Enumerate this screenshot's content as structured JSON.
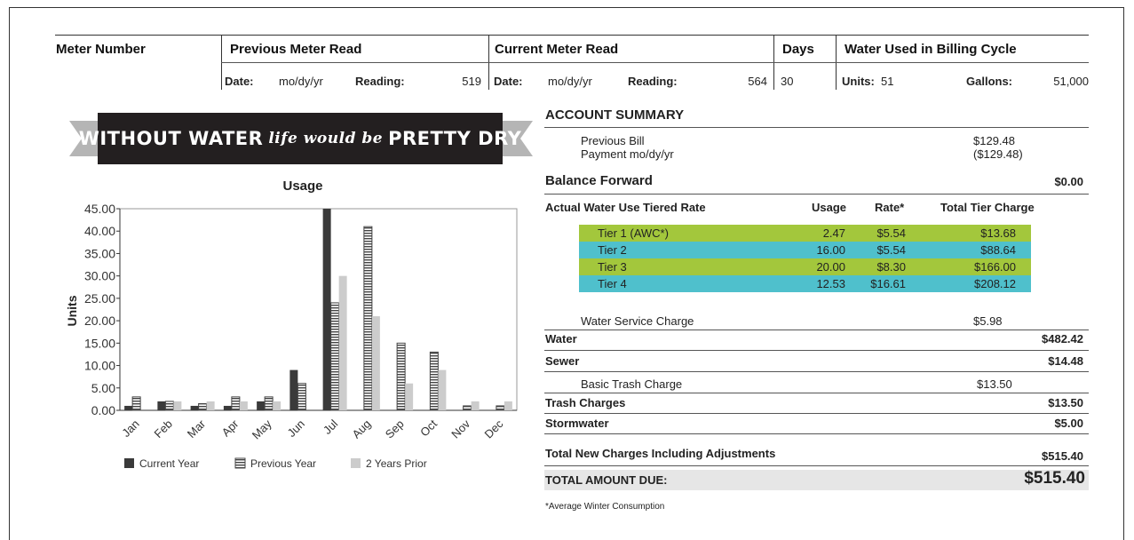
{
  "header": {
    "meter_number": "Meter Number",
    "previous_meter_read": "Previous Meter Read",
    "current_meter_read": "Current Meter Read",
    "days": "Days",
    "water_used": "Water Used in Billing Cycle",
    "prev_date_label": "Date:",
    "prev_date": "mo/dy/yr",
    "prev_reading_label": "Reading:",
    "prev_reading": "519",
    "cur_date_label": "Date:",
    "cur_date": "mo/dy/yr",
    "cur_reading_label": "Reading:",
    "cur_reading": "564",
    "days_value": "30",
    "units_label": "Units:",
    "units_value": "51",
    "gallons_label": "Gallons:",
    "gallons_value": "51,000"
  },
  "banner": {
    "part1": "WITHOUT WATER",
    "part2": "life would be",
    "part3": "PRETTY DRY"
  },
  "account": {
    "title": "ACCOUNT SUMMARY",
    "previous_bill_label": "Previous Bill",
    "previous_bill": "$129.48",
    "payment_label": "Payment mo/dy/yr",
    "payment": "($129.48)",
    "balance_forward_label": "Balance Forward",
    "balance_forward": "$0.00",
    "tier_header": {
      "name": "Actual Water Use Tiered Rate",
      "usage": "Usage",
      "rate": "Rate*",
      "total": "Total Tier Charge"
    },
    "tiers": [
      {
        "name": "Tier 1 (AWC*)",
        "usage": "2.47",
        "rate": "$5.54",
        "total": "$13.68"
      },
      {
        "name": "Tier 2",
        "usage": "16.00",
        "rate": "$5.54",
        "total": "$88.64"
      },
      {
        "name": "Tier 3",
        "usage": "20.00",
        "rate": "$8.30",
        "total": "$166.00"
      },
      {
        "name": "Tier 4",
        "usage": "12.53",
        "rate": "$16.61",
        "total": "$208.12"
      }
    ],
    "tier_colors": [
      "#a3c73c",
      "#4fc0cc",
      "#a3c73c",
      "#4fc0cc"
    ],
    "water_service_label": "Water Service Charge",
    "water_service": "$5.98",
    "water_label": "Water",
    "water": "$482.42",
    "sewer_label": "Sewer",
    "sewer": "$14.48",
    "basic_trash_label": "Basic Trash Charge",
    "basic_trash": "$13.50",
    "trash_label": "Trash Charges",
    "trash": "$13.50",
    "storm_label": "Stormwater",
    "storm": "$5.00",
    "total_new_label": "Total New Charges Including Adjustments",
    "total_new": "$515.40",
    "total_due_label": "TOTAL AMOUNT DUE:",
    "total_due": "$515.40",
    "footnote": "*Average Winter Consumption"
  },
  "chart_data": {
    "type": "bar",
    "title": "Usage",
    "xlabel": "",
    "ylabel": "Units",
    "ylim": [
      0,
      45
    ],
    "yticks": [
      "0.00",
      "5.00",
      "10.00",
      "15.00",
      "20.00",
      "25.00",
      "30.00",
      "35.00",
      "40.00",
      "45.00"
    ],
    "categories": [
      "Jan",
      "Feb",
      "Mar",
      "Apr",
      "May",
      "Jun",
      "Jul",
      "Aug",
      "Sep",
      "Oct",
      "Nov",
      "Dec"
    ],
    "series": [
      {
        "name": "Current Year",
        "values": [
          1,
          2,
          1,
          1,
          2,
          9,
          45,
          null,
          null,
          null,
          null,
          null
        ]
      },
      {
        "name": "Previous Year",
        "values": [
          3,
          2,
          1.5,
          3,
          3,
          6,
          24,
          41,
          15,
          13,
          1,
          1
        ]
      },
      {
        "name": "2 Years Prior",
        "values": [
          null,
          2,
          2,
          2,
          2,
          null,
          30,
          21,
          6,
          9,
          2,
          2
        ]
      }
    ],
    "colors": [
      "#3a3a3a",
      "#555555",
      "#cccccc"
    ],
    "legend_position": "bottom",
    "grid": false
  }
}
